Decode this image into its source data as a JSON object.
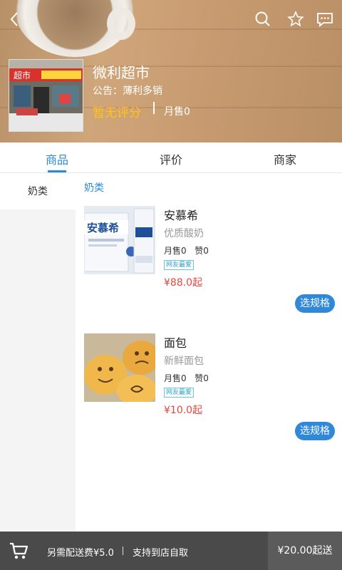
{
  "header": {
    "store_name": "微利超市",
    "notice": "公告：薄利多销",
    "rating": "暂无评分",
    "monthly_sales": "月售0",
    "store_sign": "超市"
  },
  "tabs": [
    {
      "label": "商品",
      "active": true
    },
    {
      "label": "评价",
      "active": false
    },
    {
      "label": "商家",
      "active": false
    }
  ],
  "sidebar": {
    "items": [
      {
        "label": "奶类",
        "selected": true
      }
    ]
  },
  "category_title": "奶类",
  "products": [
    {
      "name": "安慕希",
      "desc": "优质酸奶",
      "sales": "月售0",
      "likes": "赞0",
      "tag": "网友最爱",
      "price": "¥88.0起",
      "button": "选规格",
      "brand_text": "安慕希"
    },
    {
      "name": "面包",
      "desc": "新鲜面包",
      "sales": "月售0",
      "likes": "赞0",
      "tag": "网友最爱",
      "price": "¥10.0起",
      "button": "选规格"
    }
  ],
  "footer": {
    "delivery_fee": "另需配送费¥5.0",
    "pickup": "支持到店自取",
    "checkout": "¥20.00起送"
  },
  "colors": {
    "accent": "#2a8bd8",
    "price": "#e8453c",
    "rating": "#ffc21a",
    "footer_bg": "#4a4a4a"
  }
}
